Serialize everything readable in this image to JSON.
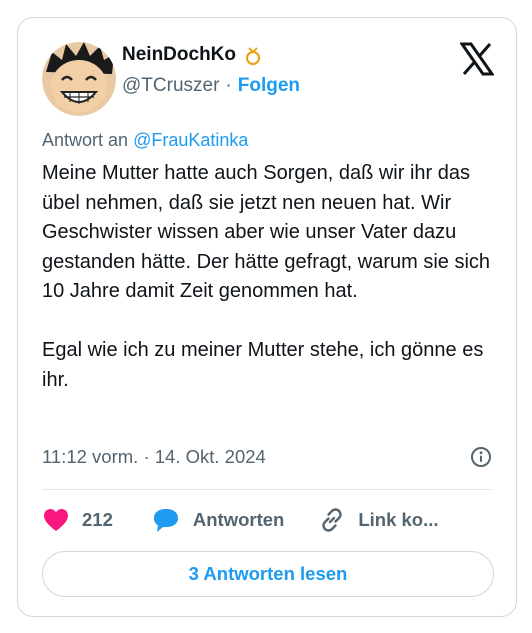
{
  "author": {
    "name": "NeinDochKo",
    "handle": "@TCruszer",
    "separator": "·",
    "follow_label": "Folgen"
  },
  "reply_to": {
    "prefix": "Antwort an",
    "user": "@FrauKatinka"
  },
  "tweet": {
    "paragraph_1": "Meine Mutter hatte auch Sorgen, daß wir ihr das übel nehmen, daß sie jetzt nen neuen hat. Wir Geschwister wissen aber wie unser Vater dazu gestanden hätte. Der hätte gefragt, warum sie sich 10 Jahre damit Zeit genommen hat.",
    "paragraph_2": "Egal wie ich zu meiner Mutter stehe, ich gönne es ihr.",
    "timestamp": "11:12 vorm. · 14. Okt. 2024"
  },
  "actions": {
    "like_count": "212",
    "reply_label": "Antworten",
    "copy_link_label": "Link ko..."
  },
  "read_replies_label": "3 Antworten lesen",
  "colors": {
    "accent": "#1d9bf0",
    "like": "#f91880",
    "reply_icon": "#1d9bf0",
    "text_secondary": "#536471",
    "border": "#cfd9de"
  },
  "icons": {
    "logo": "x-logo-icon",
    "badge": "ring-badge-icon",
    "info": "info-icon",
    "like": "heart-icon",
    "reply": "speech-bubble-icon",
    "copy": "link-icon"
  }
}
